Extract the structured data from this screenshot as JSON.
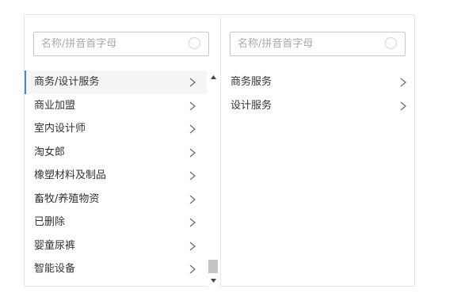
{
  "left": {
    "search_placeholder": "名称/拼音首字母",
    "items": [
      {
        "label": "商务/设计服务",
        "selected": true
      },
      {
        "label": "商业加盟"
      },
      {
        "label": "室内设计师"
      },
      {
        "label": "淘女郎"
      },
      {
        "label": "橡塑材料及制品"
      },
      {
        "label": "畜牧/养殖物资"
      },
      {
        "label": "已删除"
      },
      {
        "label": "婴童尿裤"
      },
      {
        "label": "智能设备"
      }
    ]
  },
  "right": {
    "search_placeholder": "名称/拼音首字母",
    "items": [
      {
        "label": "商务服务"
      },
      {
        "label": "设计服务"
      }
    ]
  },
  "icons": {
    "search": "search-icon",
    "chevron": "chevron-right-icon",
    "scroll_up": "scroll-up-arrow-icon",
    "scroll_down": "scroll-down-arrow-icon"
  },
  "colors": {
    "accent": "#3d8cc6",
    "selected_bg": "#f5f5f5",
    "border": "#c8c8c8",
    "placeholder": "#a9a9a9"
  }
}
